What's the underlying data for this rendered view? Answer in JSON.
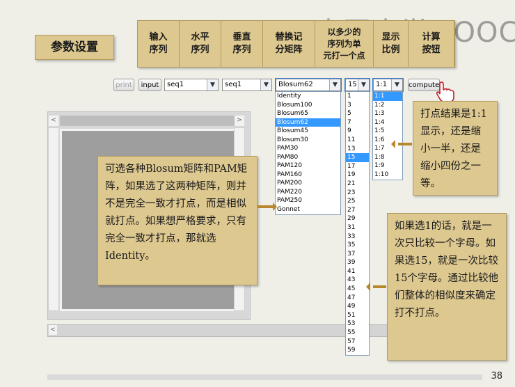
{
  "title": "参数设置",
  "headers": [
    "输入\n序列",
    "水平\n序列",
    "垂直\n序列",
    "替换记\n分矩阵",
    "以多少的\n序列为单\n元打一个点",
    "显示\n比例",
    "计算\n按钮"
  ],
  "toolbar": {
    "print_label": "print",
    "input_label": "input",
    "horizontal_seq": "seq1",
    "vertical_seq": "seq1",
    "matrix": "Blosum62",
    "window": "15",
    "scale": "1:1",
    "compute_label": "compute"
  },
  "matrix_options": [
    "Identity",
    "Blosum100",
    "Blosum65",
    "Blosum62",
    "Blosum45",
    "Blosum30",
    "PAM30",
    "PAM80",
    "PAM120",
    "PAM160",
    "PAM200",
    "PAM220",
    "PAM250",
    "Gonnet"
  ],
  "window_options": [
    "1",
    "3",
    "5",
    "7",
    "9",
    "11",
    "13",
    "15",
    "17",
    "19",
    "21",
    "23",
    "25",
    "27",
    "29",
    "31",
    "33",
    "35",
    "37",
    "39",
    "41",
    "43",
    "45",
    "47",
    "49",
    "51",
    "53",
    "55",
    "57",
    "59"
  ],
  "scale_options": [
    "1:1",
    "1:2",
    "1:3",
    "1:4",
    "1:5",
    "1:6",
    "1:7",
    "1:8",
    "1:9",
    "1:10"
  ],
  "notes": {
    "matrix_note": "可选各种Blosum矩阵和PAM矩阵，如果选了这两种矩阵，则并不是完全一致才打点，而是相似就打点。如果想严格要求，只有完全一致才打点，那就选Identity。",
    "scale_note": "打点结果是1:1显示，还是缩小一半，还是缩小四份之一等。",
    "window_note": "如果选1的话，就是一次只比较一个字母。如果选15，就是一次比较15个字母。通过比较他们整体的相似度来确定打不打点。"
  },
  "logo": "中国大学MOOC",
  "page_number": "38",
  "colors": {
    "note_bg": "#ddc890",
    "selected": "#3399ff",
    "arrow": "#b8862b"
  }
}
